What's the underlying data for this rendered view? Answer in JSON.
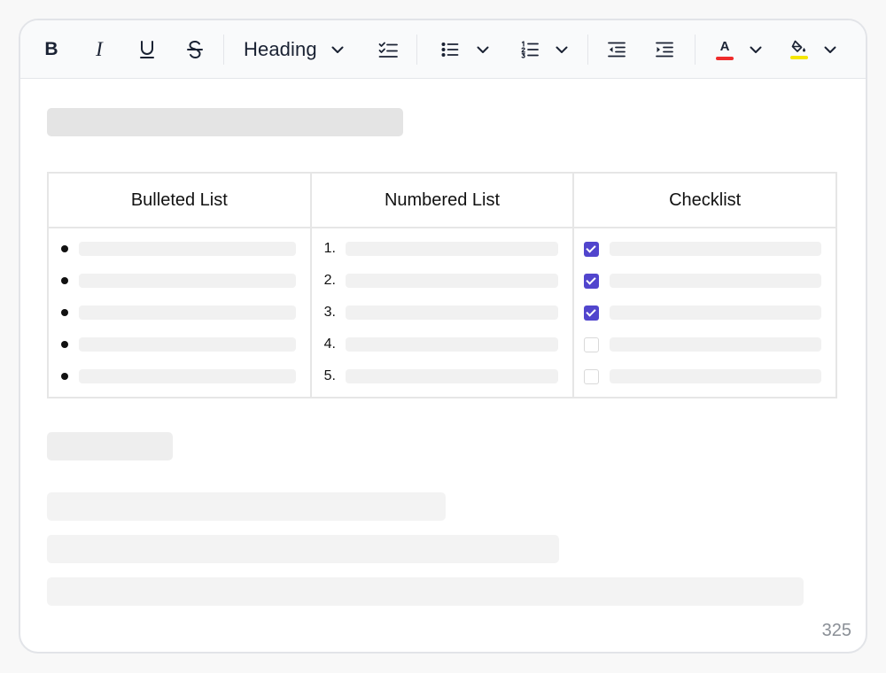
{
  "toolbar": {
    "heading_label": "Heading",
    "buttons": [
      {
        "name": "bold-button",
        "glyph": "B"
      },
      {
        "name": "italic-button",
        "glyph": "I"
      },
      {
        "name": "underline-button",
        "glyph": "U"
      },
      {
        "name": "strikethrough-button",
        "glyph": "S"
      }
    ],
    "text_color_glyph": "A",
    "text_color": "#ef2b2b",
    "highlight_color": "#f5e600"
  },
  "table": {
    "headers": [
      "Bulleted List",
      "Numbered List",
      "Checklist"
    ],
    "numbers": [
      "1.",
      "2.",
      "3.",
      "4.",
      "5."
    ],
    "checklist_checked": [
      true,
      true,
      true,
      false,
      false
    ]
  },
  "footer": {
    "char_count": "325"
  },
  "colors": {
    "accent": "#5145cd",
    "border": "#e6e6e6"
  }
}
